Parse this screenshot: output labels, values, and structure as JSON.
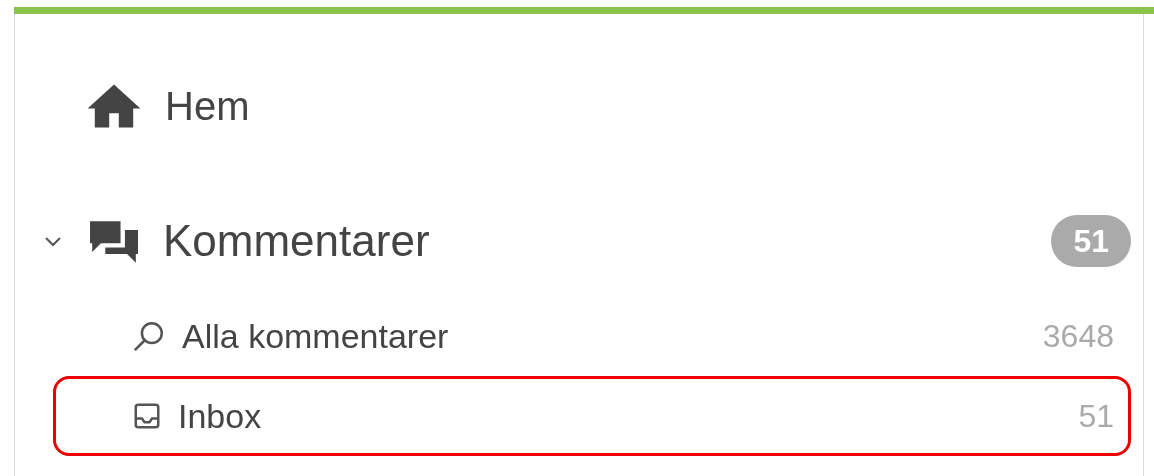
{
  "home": {
    "label": "Hem"
  },
  "section": {
    "label": "Kommentarer",
    "expanded": true,
    "badge": "51",
    "items": [
      {
        "kind": "search",
        "label": "Alla kommentarer",
        "count": "3648",
        "highlighted": false
      },
      {
        "kind": "inbox",
        "label": "Inbox",
        "count": "51",
        "highlighted": true
      }
    ]
  }
}
